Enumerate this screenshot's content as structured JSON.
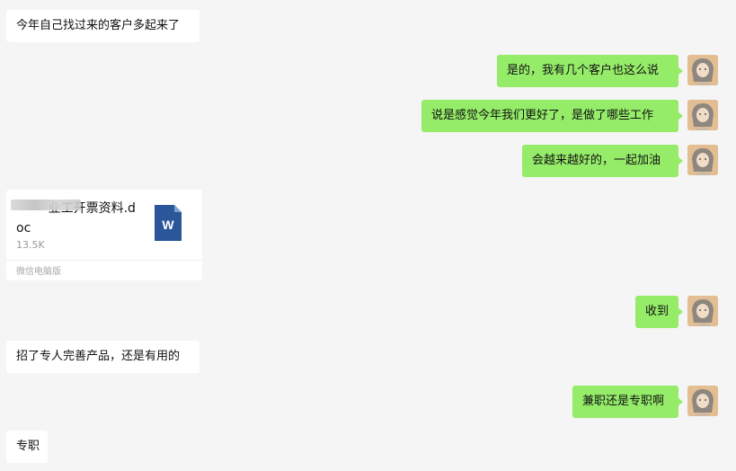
{
  "messages": [
    {
      "side": "in",
      "text": "今年自己找过来的客户多起来了"
    },
    {
      "side": "out",
      "text": "是的，我有几个客户也这么说"
    },
    {
      "side": "out",
      "text": "说是感觉今年我们更好了，是做了哪些工作"
    },
    {
      "side": "out",
      "text": "会越来越好的，一起加油"
    },
    {
      "side": "out",
      "text": "收到"
    },
    {
      "side": "in",
      "text": "招了专人完善产品，还是有用的"
    },
    {
      "side": "out",
      "text": "兼职还是专职啊"
    },
    {
      "side": "in",
      "text": "专职"
    }
  ],
  "file": {
    "name": "        业工开票资料.doc",
    "size": "13.5K",
    "source": "微信电脑版",
    "icon": "word-doc-icon",
    "icon_letter": "W",
    "icon_color": "#2b579a"
  },
  "colors": {
    "background": "#f5f5f5",
    "incoming_bubble": "#ffffff",
    "outgoing_bubble": "#95ec69"
  }
}
